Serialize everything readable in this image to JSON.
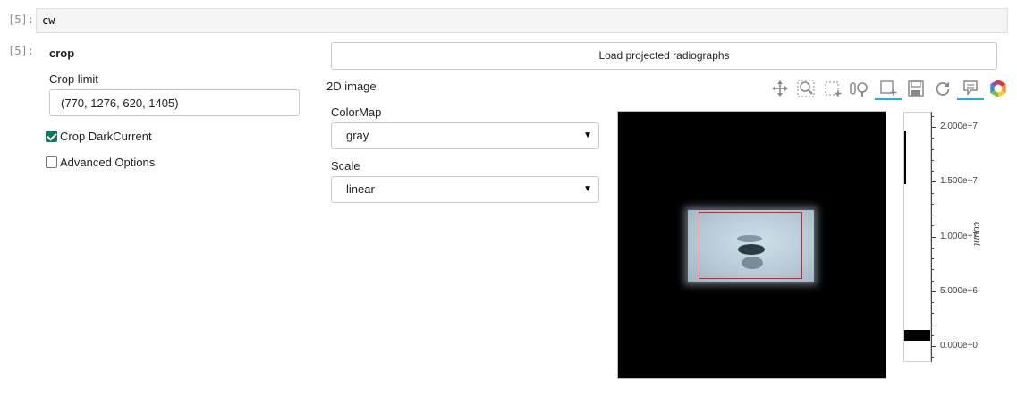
{
  "input_cell": {
    "prompt": "[5]:",
    "code": "cw"
  },
  "output_cell": {
    "prompt": "[5]:"
  },
  "crop_panel": {
    "title": "crop",
    "crop_limit_label": "Crop limit",
    "crop_limit_value": "(770, 1276, 620, 1405)",
    "crop_darkcurrent_label": "Crop DarkCurrent",
    "crop_darkcurrent_checked": true,
    "advanced_options_label": "Advanced Options",
    "advanced_options_checked": false
  },
  "load_button_label": "Load projected radiographs",
  "image_panel": {
    "title": "2D image",
    "colormap_label": "ColorMap",
    "colormap_value": "gray",
    "scale_label": "Scale",
    "scale_value": "linear"
  },
  "toolbar": {
    "tools": [
      {
        "name": "pan-icon",
        "active": false
      },
      {
        "name": "box-zoom-icon",
        "active": false
      },
      {
        "name": "box-select-icon",
        "active": false
      },
      {
        "name": "wheel-zoom-icon",
        "active": false
      },
      {
        "name": "box-edit-icon",
        "active": true
      },
      {
        "name": "save-icon",
        "active": false
      },
      {
        "name": "reset-icon",
        "active": false
      },
      {
        "name": "hover-icon",
        "active": true
      },
      {
        "name": "bokeh-logo",
        "active": false
      }
    ]
  },
  "colorbar": {
    "axis_label": "count",
    "tick_labels": [
      "2.000e+7",
      "1.500e+7",
      "1.000e+7",
      "5.000e+6",
      "0.000e+0"
    ],
    "tick_values": [
      20000000,
      15000000,
      10000000,
      5000000,
      0
    ]
  },
  "colors": {
    "checkbox_accent": "#0d7a5f",
    "crop_rect": "#e0201d",
    "toolbar_active": "#26aae1",
    "image_background": "#000000"
  }
}
